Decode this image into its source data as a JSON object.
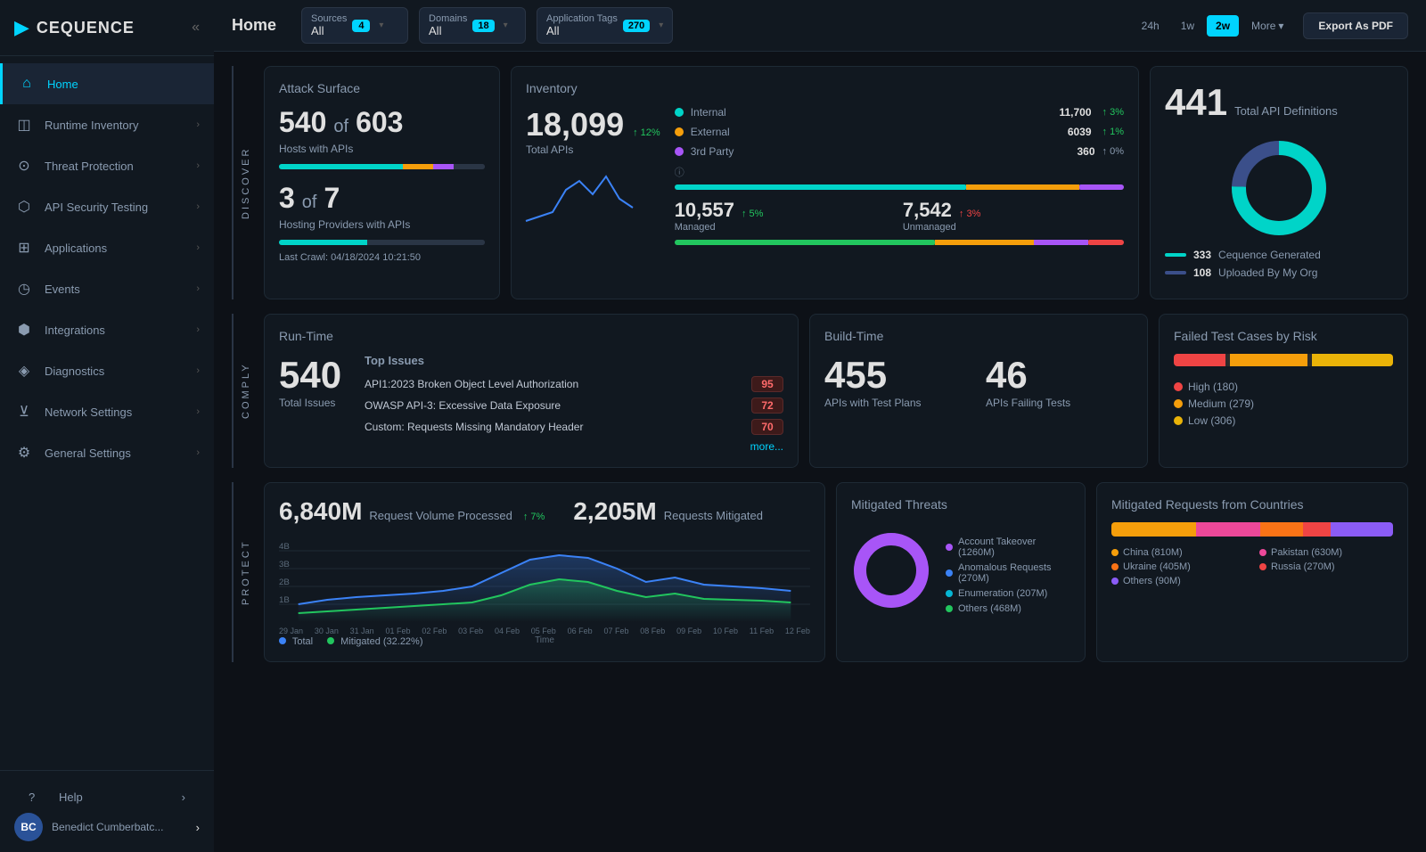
{
  "app": {
    "name": "CEQUENCE"
  },
  "sidebar": {
    "items": [
      {
        "id": "home",
        "label": "Home",
        "icon": "⌂",
        "active": true
      },
      {
        "id": "runtime-inventory",
        "label": "Runtime Inventory",
        "icon": "◫",
        "active": false
      },
      {
        "id": "threat-protection",
        "label": "Threat Protection",
        "icon": "⊙",
        "active": false
      },
      {
        "id": "api-security-testing",
        "label": "API Security Testing",
        "icon": "⬡",
        "active": false
      },
      {
        "id": "applications",
        "label": "Applications",
        "icon": "⊞",
        "active": false
      },
      {
        "id": "events",
        "label": "Events",
        "icon": "◷",
        "active": false
      },
      {
        "id": "integrations",
        "label": "Integrations",
        "icon": "⬢",
        "active": false
      },
      {
        "id": "diagnostics",
        "label": "Diagnostics",
        "icon": "◈",
        "active": false
      },
      {
        "id": "network-settings",
        "label": "Network Settings",
        "icon": "⊻",
        "active": false
      },
      {
        "id": "general-settings",
        "label": "General Settings",
        "icon": "⚙",
        "active": false
      }
    ],
    "help_label": "Help",
    "user": {
      "initials": "BC",
      "name": "Benedict Cumberbatc..."
    }
  },
  "topbar": {
    "page_title": "Home",
    "filters": {
      "sources": {
        "label": "Sources",
        "value": "All",
        "count": "4"
      },
      "domains": {
        "label": "Domains",
        "value": "All",
        "count": "18"
      },
      "app_tags": {
        "label": "Application Tags",
        "value": "All",
        "count": "270"
      }
    },
    "time_buttons": [
      "24h",
      "1w",
      "2w"
    ],
    "active_time": "2w",
    "more_label": "More",
    "export_label": "Export As PDF"
  },
  "discover": {
    "section_label": "Discover",
    "attack_surface": {
      "title": "Attack Surface",
      "hosts_num": "540",
      "hosts_of": "of",
      "hosts_total": "603",
      "hosts_label": "Hosts with APIs",
      "providers_num": "3",
      "providers_of": "of",
      "providers_total": "7",
      "providers_label": "Hosting Providers with APIs",
      "last_crawl_label": "Last Crawl:",
      "last_crawl_value": "04/18/2024 10:21:50"
    },
    "inventory": {
      "title": "Inventory",
      "total_apis": "18,099",
      "total_apis_label": "Total APIs",
      "trend": "↑ 12%",
      "breakdown": [
        {
          "label": "Internal",
          "value": "11,700",
          "trend": "↑ 3%",
          "color": "#00d4c8"
        },
        {
          "label": "External",
          "value": "6039",
          "trend": "↑ 1%",
          "color": "#f59e0b"
        },
        {
          "label": "3rd Party",
          "value": "360",
          "trend": "↑ 0%",
          "color": "#a855f7"
        }
      ],
      "managed_num": "10,557",
      "managed_trend": "↑ 5%",
      "managed_label": "Managed",
      "unmanaged_num": "7,542",
      "unmanaged_trend": "↑ 3%",
      "unmanaged_label": "Unmanaged"
    },
    "api_definitions": {
      "count": "441",
      "label": "Total API Definitions",
      "cequence_generated": "333",
      "cequence_label": "Cequence Generated",
      "uploaded": "108",
      "uploaded_label": "Uploaded By My Org"
    }
  },
  "comply": {
    "section_label": "Comply",
    "runtime": {
      "title": "Run-Time",
      "total_issues": "540",
      "total_issues_label": "Total Issues",
      "top_issues_title": "Top Issues",
      "issues": [
        {
          "label": "API1:2023 Broken Object Level Authorization",
          "count": "95"
        },
        {
          "label": "OWASP API-3: Excessive Data Exposure",
          "count": "72"
        },
        {
          "label": "Custom: Requests Missing Mandatory Header",
          "count": "70"
        }
      ],
      "more_label": "more..."
    },
    "build_time": {
      "title": "Build-Time",
      "apis_with_tests": "455",
      "apis_with_tests_label": "APIs with Test Plans",
      "apis_failing": "46",
      "apis_failing_label": "APIs Failing Tests"
    },
    "risk_chart": {
      "title": "Failed Test Cases by Risk",
      "high": 180,
      "medium": 279,
      "low": 306,
      "high_label": "High (180)",
      "medium_label": "Medium (279)",
      "low_label": "Low (306)",
      "high_color": "#ef4444",
      "medium_color": "#f59e0b",
      "low_color": "#eab308"
    }
  },
  "protect": {
    "section_label": "Protect",
    "volume": {
      "number": "6,840M",
      "label": "Request Volume Processed",
      "trend": "↑ 7%"
    },
    "mitigated": {
      "number": "2,205M",
      "label": "Requests Mitigated",
      "threats_title": "Mitigated Threats",
      "threats": [
        {
          "label": "Account Takeover (1260M)",
          "color": "#a855f7"
        },
        {
          "label": "Anomalous Requests (270M)",
          "color": "#3b82f6"
        },
        {
          "label": "Enumeration (207M)",
          "color": "#06b6d4"
        },
        {
          "label": "Others (468M)",
          "color": "#22c55e"
        }
      ]
    },
    "countries": {
      "title": "Mitigated Requests from Countries",
      "bars": [
        {
          "label": "China (810M)",
          "color": "#f59e0b",
          "pct": 30
        },
        {
          "label": "Pakistan (630M)",
          "color": "#ec4899",
          "pct": 23
        },
        {
          "label": "Ukraine (405M)",
          "color": "#f97316",
          "pct": 15
        },
        {
          "label": "Russia (270M)",
          "color": "#ef4444",
          "pct": 10
        },
        {
          "label": "Others (90M)",
          "color": "#8b5cf6",
          "pct": 22
        }
      ]
    },
    "chart_x_labels": [
      "29 Jan",
      "30 Jan",
      "31 Jan",
      "01 Feb",
      "02 Feb",
      "03 Feb",
      "04 Feb",
      "05 Feb",
      "06 Feb",
      "07 Feb",
      "08 Feb",
      "09 Feb",
      "10 Feb",
      "11 Feb",
      "12 Feb"
    ],
    "legend_total": "Total",
    "legend_mitigated": "Mitigated (32.22%)"
  }
}
